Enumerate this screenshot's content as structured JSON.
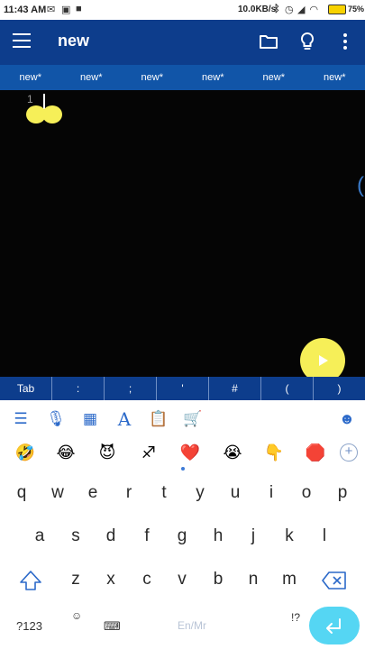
{
  "status_bar": {
    "time": "11:43 AM",
    "network_speed": "10.0KB/s",
    "battery_percent": "75%"
  },
  "app_bar": {
    "title": "new",
    "icons": [
      "menu-icon",
      "folder-icon",
      "lightbulb-icon",
      "more-vert-icon"
    ]
  },
  "tabs": [
    "new*",
    "new*",
    "new*",
    "new*",
    "new*",
    "new*"
  ],
  "editor": {
    "line_numbers": [
      "1"
    ],
    "edge_text": "("
  },
  "symbol_bar": [
    "Tab",
    ":",
    ";",
    "'",
    "#",
    "(",
    ")"
  ],
  "keyboard": {
    "toolbar_icons": [
      "text-lines-icon",
      "microphone-icon",
      "film-icon",
      "font-icon",
      "clipboard-icon",
      "cart-icon",
      "emoji-face-icon"
    ],
    "emoji_row": [
      "🤣",
      "😂",
      "😈",
      "♐",
      "❤️",
      "😭",
      "👇",
      "🛑"
    ],
    "row1": [
      "q",
      "w",
      "e",
      "r",
      "t",
      "y",
      "u",
      "i",
      "o",
      "p"
    ],
    "row2": [
      "a",
      "s",
      "d",
      "f",
      "g",
      "h",
      "j",
      "k",
      "l"
    ],
    "row3": [
      "z",
      "x",
      "c",
      "v",
      "b",
      "n",
      "m"
    ],
    "bottom": {
      "mode": "?123",
      "emoji": "☺",
      "lang_label": "En/Mr",
      "punct": "!?"
    }
  },
  "colors": {
    "app_bar": "#0d3d8c",
    "tab_bar": "#1155a8",
    "editor_bg": "#050505",
    "fab": "#f6ef58",
    "enter_key": "#55d6f3"
  }
}
